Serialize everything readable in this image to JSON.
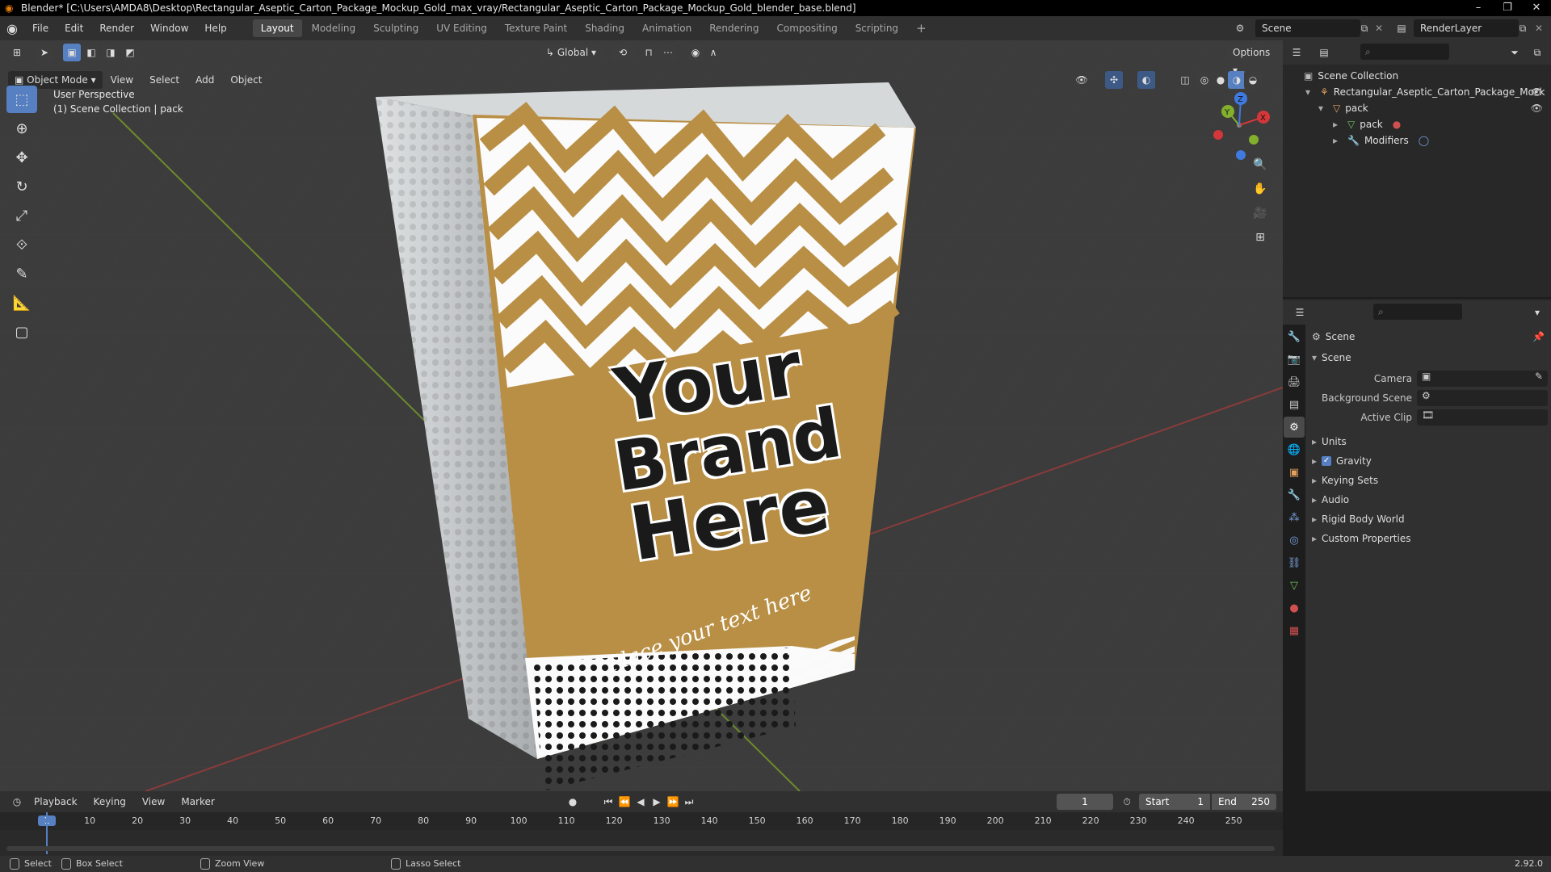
{
  "window": {
    "title": "Blender* [C:\\Users\\AMDA8\\Desktop\\Rectangular_Aseptic_Carton_Package_Mockup_Gold_max_vray/Rectangular_Aseptic_Carton_Package_Mockup_Gold_blender_base.blend]"
  },
  "menu": [
    "File",
    "Edit",
    "Render",
    "Window",
    "Help"
  ],
  "workspaces": [
    "Layout",
    "Modeling",
    "Sculpting",
    "UV Editing",
    "Texture Paint",
    "Shading",
    "Animation",
    "Rendering",
    "Compositing",
    "Scripting"
  ],
  "scene": {
    "name": "Scene",
    "render_layer": "RenderLayer"
  },
  "viewport": {
    "mode": "Object Mode",
    "menus": [
      "View",
      "Select",
      "Add",
      "Object"
    ],
    "transform_orientation": "Global",
    "options_label": "Options",
    "info_line1": "User Perspective",
    "info_line2": "(1) Scene Collection | pack",
    "gizmo": {
      "x": "X",
      "y": "Y",
      "z": "Z"
    }
  },
  "package": {
    "brand_line1": "Your",
    "brand_line2": "Brand",
    "brand_line3": "Here",
    "tagline": "Place your text here",
    "gold": "#b98f45"
  },
  "outliner": {
    "root": "Scene Collection",
    "items": [
      {
        "label": "Rectangular_Aseptic_Carton_Package_Mock"
      },
      {
        "label": "pack"
      },
      {
        "label": "pack"
      },
      {
        "label": "Modifiers"
      }
    ]
  },
  "properties": {
    "header": "Scene",
    "panel": "Scene",
    "fields": [
      {
        "label": "Camera"
      },
      {
        "label": "Background Scene"
      },
      {
        "label": "Active Clip"
      }
    ],
    "sections": [
      "Units",
      "Gravity",
      "Keying Sets",
      "Audio",
      "Rigid Body World",
      "Custom Properties"
    ]
  },
  "timeline": {
    "menus": [
      "Playback",
      "Keying",
      "View",
      "Marker"
    ],
    "current_frame": "1",
    "start_label": "Start",
    "start": "1",
    "end_label": "End",
    "end": "250",
    "ticks": [
      "1",
      "10",
      "20",
      "30",
      "40",
      "50",
      "60",
      "70",
      "80",
      "90",
      "100",
      "110",
      "120",
      "130",
      "140",
      "150",
      "160",
      "170",
      "180",
      "190",
      "200",
      "210",
      "220",
      "230",
      "240",
      "250"
    ]
  },
  "status": {
    "select": "Select",
    "box_select": "Box Select",
    "zoom_view": "Zoom View",
    "lasso_select": "Lasso Select",
    "version": "2.92.0"
  },
  "colors": {
    "accent": "#5680c2",
    "x_axis": "#d4373a",
    "y_axis": "#83b02c",
    "z_axis": "#3f7ae0"
  }
}
